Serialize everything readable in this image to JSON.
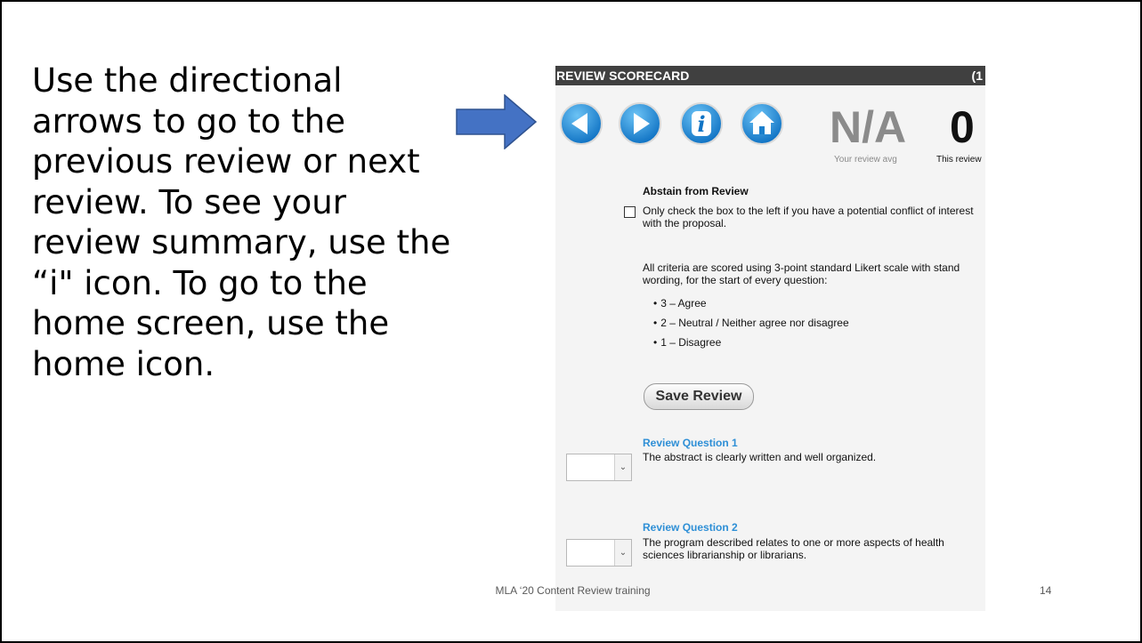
{
  "slide": {
    "instruction": "Use the directional\narrows to go to the\nprevious review or next\nreview. To see your\nreview summary, use the\n“i\" icon. To go to the\nhome screen, use the\nhome icon.",
    "footer": "MLA ‘20 Content Review training",
    "page_number": "14"
  },
  "scorecard": {
    "title": "REVIEW SCORECARD",
    "counter": "(1",
    "nav": {
      "prev_icon": "chevron-left-icon",
      "next_icon": "chevron-right-icon",
      "info_icon": "info-icon",
      "home_icon": "home-icon"
    },
    "review_avg_value": "N/A",
    "review_avg_caption": "Your review avg",
    "this_review_value": "0",
    "this_review_caption": "This review",
    "abstain": {
      "title": "Abstain from Review",
      "text": "Only check the box to the left if you have a potential conflict of interest with the proposal.",
      "checked": false
    },
    "criteria_note_line1": "All criteria are scored using 3-point standard Likert scale with stand",
    "criteria_note_line2": "wording, for the start of every question:",
    "scale": [
      "3 – Agree",
      "2 – Neutral / Neither agree nor disagree",
      "1 – Disagree"
    ],
    "save_label": "Save Review",
    "questions": [
      {
        "title": "Review Question 1",
        "text": "The abstract is clearly written and well organized.",
        "selected": ""
      },
      {
        "title": "Review Question 2",
        "text": "The program described relates to one or more aspects of health sciences librarianship or librarians.",
        "selected": ""
      }
    ]
  },
  "colors": {
    "header_bg": "#404040",
    "nav_button": "#1e90d8",
    "question_title": "#2e8fd6",
    "arrow": "#4472c4"
  }
}
